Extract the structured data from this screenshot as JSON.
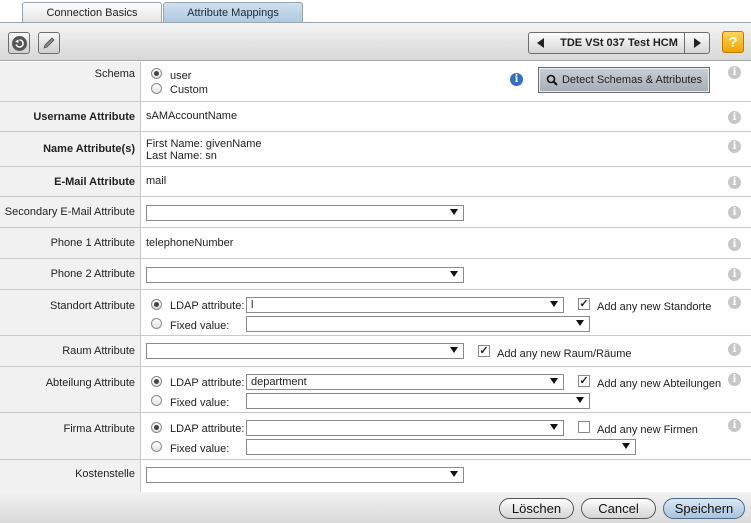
{
  "tabs": [
    {
      "label": "Connection Basics",
      "active": false
    },
    {
      "label": "Attribute Mappings",
      "active": true
    }
  ],
  "toolbar": {
    "back_icon": "back-arrow-icon",
    "edit_icon": "pencil-icon",
    "prev_icon": "triangle-left-icon",
    "next_icon": "triangle-right-icon",
    "record_label": "TDE VSt 037 Test HCM",
    "help_label": "?"
  },
  "schema": {
    "label": "Schema",
    "options": [
      {
        "label": "user",
        "selected": true
      },
      {
        "label": "Custom",
        "selected": false
      }
    ],
    "detect_button": "Detect Schemas & Attributes"
  },
  "username_attribute": {
    "label": "Username Attribute",
    "value": "sAMAccountName"
  },
  "name_attributes": {
    "label": "Name Attribute(s)",
    "line1": "First Name: givenName",
    "line2": "Last Name: sn"
  },
  "email_attribute": {
    "label": "E-Mail Attribute",
    "value": "mail"
  },
  "secondary_email": {
    "label": "Secondary E-Mail Attribute",
    "value": ""
  },
  "phone1": {
    "label": "Phone 1 Attribute",
    "value": "telephoneNumber"
  },
  "phone2": {
    "label": "Phone 2 Attribute",
    "value": ""
  },
  "standort": {
    "label": "Standort Attribute",
    "ldap_label": "LDAP attribute:",
    "ldap_value": "l",
    "ldap_selected": true,
    "fixed_label": "Fixed value:",
    "fixed_value": "",
    "add_new_label": "Add any new Standorte",
    "add_new_checked": true
  },
  "raum": {
    "label": "Raum Attribute",
    "value": "",
    "add_new_label": "Add any new Raum/Räume",
    "add_new_checked": true
  },
  "abteilung": {
    "label": "Abteilung Attribute",
    "ldap_label": "LDAP attribute:",
    "ldap_value": "department",
    "ldap_selected": true,
    "fixed_label": "Fixed value:",
    "fixed_value": "",
    "add_new_label": "Add any new Abteilungen",
    "add_new_checked": true
  },
  "firma": {
    "label": "Firma Attribute",
    "ldap_label": "LDAP attribute:",
    "ldap_value": "",
    "ldap_selected": true,
    "fixed_label": "Fixed value:",
    "fixed_value": "",
    "add_new_label": "Add any new Firmen",
    "add_new_checked": false
  },
  "kostenstelle": {
    "label": "Kostenstelle",
    "value": ""
  },
  "footer": {
    "delete": "Löschen",
    "cancel": "Cancel",
    "save": "Speichern"
  },
  "colors": {
    "active_tab": "#aec8de",
    "help_button": "#f0a400",
    "info_blue": "#2f6fc7"
  }
}
